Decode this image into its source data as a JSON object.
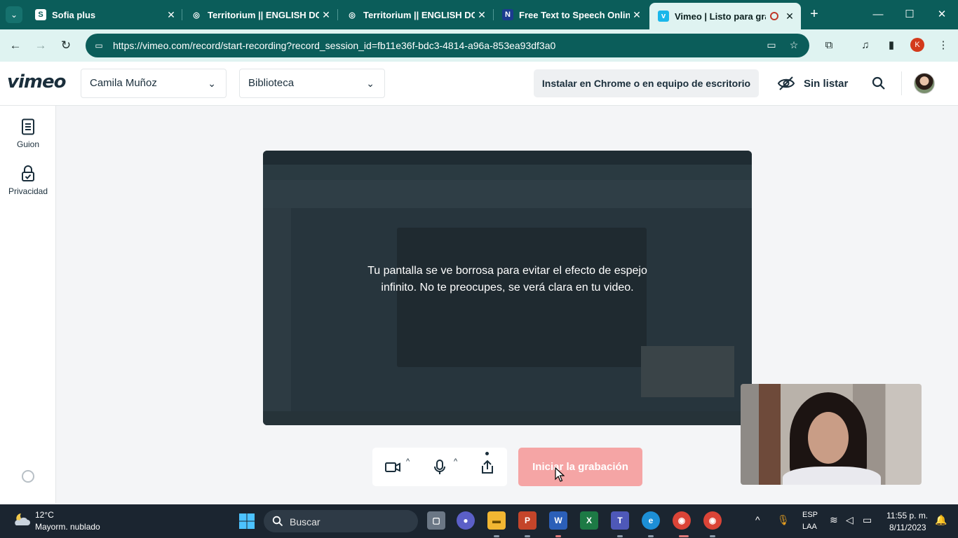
{
  "browser": {
    "tabs": [
      {
        "title": "Sofia plus",
        "favicon": "sofia-plus-icon"
      },
      {
        "title": "Territorium || ENGLISH DOE",
        "favicon": "territorium-icon"
      },
      {
        "title": "Territorium || ENGLISH DOE",
        "favicon": "territorium-icon"
      },
      {
        "title": "Free Text to Speech Online",
        "favicon": "naturalreaders-icon"
      },
      {
        "title": "Vimeo | Listo para grab",
        "favicon": "vimeo-icon",
        "recording_indicator": "record-icon"
      }
    ],
    "url": "https://vimeo.com/record/start-recording?record_session_id=fb11e36f-bdc3-4814-a96a-853ea93df3a0",
    "profile_initial": "K"
  },
  "vimeo": {
    "logo": "vimeo",
    "account_dropdown": "Camila Muñoz",
    "folder_dropdown": "Biblioteca",
    "install_button": "Instalar en Chrome o en equipo de escritorio",
    "privacy_status": "Sin listar"
  },
  "sidebar": {
    "items": [
      {
        "label": "Guion",
        "icon": "script-document-icon"
      },
      {
        "label": "Privacidad",
        "icon": "lock-check-icon"
      }
    ]
  },
  "recorder": {
    "blur_message": "Tu pantalla se ve borrosa para evitar el efecto de espejo infinito. No te preocupes, se verá clara en tu video.",
    "start_button": "Iniciar la grabación"
  },
  "taskbar": {
    "weather_temp": "12°C",
    "weather_desc": "Mayorm. nublado",
    "search_placeholder": "Buscar",
    "lang_line1": "ESP",
    "lang_line2": "LAA",
    "time": "11:55 p. m.",
    "date": "8/11/2023"
  },
  "colors": {
    "browser_frame": "#0b5d5a",
    "start_button_disabled": "#f5a5a5",
    "vimeo_text": "#1a2e3b"
  }
}
